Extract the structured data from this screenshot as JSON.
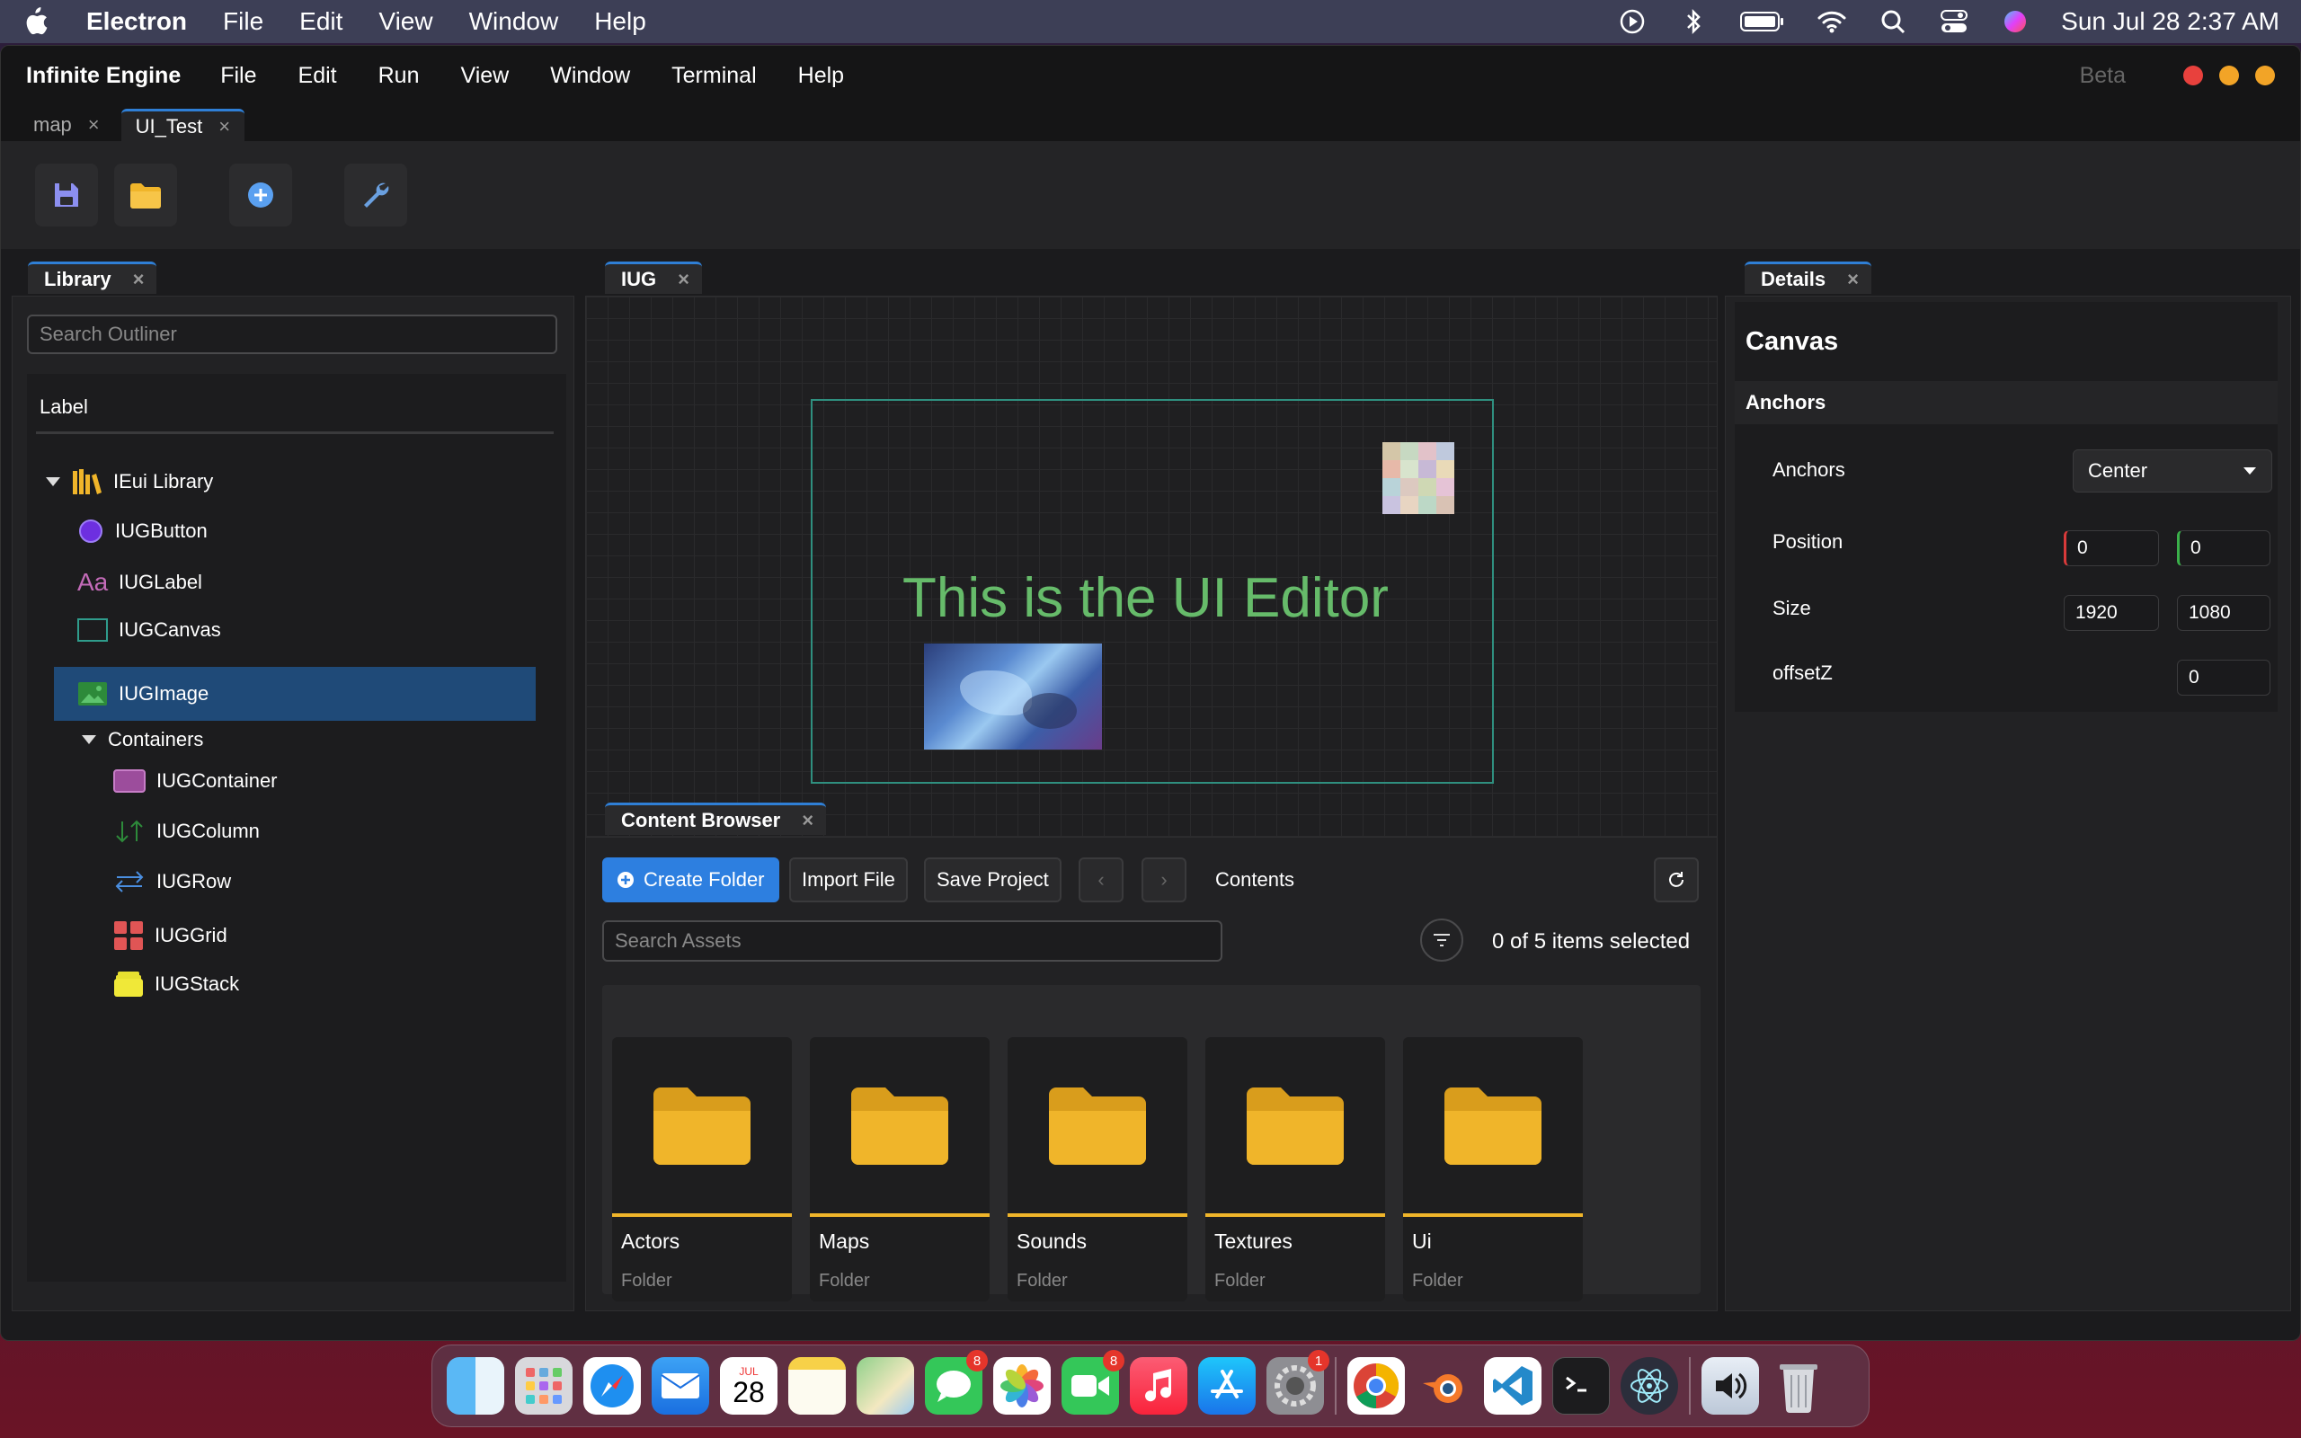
{
  "menubar": {
    "app": "Electron",
    "items": [
      "File",
      "Edit",
      "View",
      "Window",
      "Help"
    ],
    "clock": "Sun Jul 28  2:37 AM"
  },
  "appbar": {
    "title": "Infinite Engine",
    "items": [
      "File",
      "Edit",
      "Run",
      "View",
      "Window",
      "Terminal",
      "Help"
    ],
    "beta": "Beta"
  },
  "doc_tabs": [
    {
      "label": "map",
      "close": "×"
    },
    {
      "label": "UI_Test",
      "close": "×"
    }
  ],
  "library": {
    "tab": "Library",
    "close": "×",
    "search_placeholder": "Search Outliner",
    "header": "Label",
    "root": "IEui Library",
    "items": [
      "IUGButton",
      "IUGLabel",
      "IUGCanvas",
      "IUGImage"
    ],
    "group": "Containers",
    "group_items": [
      "IUGContainer",
      "IUGColumn",
      "IUGRow",
      "IUGGrid",
      "IUGStack"
    ]
  },
  "iug": {
    "tab": "IUG",
    "close": "×",
    "canvas_text": "This is the UI Editor",
    "text_color": "#66bb6a"
  },
  "content_browser": {
    "tab": "Content Browser",
    "close": "×",
    "create_folder": "Create Folder",
    "import_file": "Import File",
    "save_project": "Save Project",
    "prev": "‹",
    "next": "›",
    "contents": "Contents",
    "search_placeholder": "Search Assets",
    "selection": "0 of 5 items selected",
    "folders": [
      {
        "name": "Actors",
        "type": "Folder"
      },
      {
        "name": "Maps",
        "type": "Folder"
      },
      {
        "name": "Sounds",
        "type": "Folder"
      },
      {
        "name": "Textures",
        "type": "Folder"
      },
      {
        "name": "Ui",
        "type": "Folder"
      }
    ]
  },
  "details": {
    "tab": "Details",
    "close": "×",
    "title": "Canvas",
    "section": "Anchors",
    "anchors_label": "Anchors",
    "anchors_value": "Center",
    "position_label": "Position",
    "position_x": "0",
    "position_y": "0",
    "size_label": "Size",
    "size_w": "1920",
    "size_h": "1080",
    "offsetz_label": "offsetZ",
    "offsetz": "0"
  },
  "dock": {
    "calendar_month": "JUL",
    "calendar_day": "28",
    "badges": {
      "messages": "8",
      "facetime": "8",
      "settings": "1"
    }
  },
  "colors": {
    "accent": "#2f7fd6",
    "folder": "#f0b52a",
    "canvas_border": "#2f8f7f"
  }
}
